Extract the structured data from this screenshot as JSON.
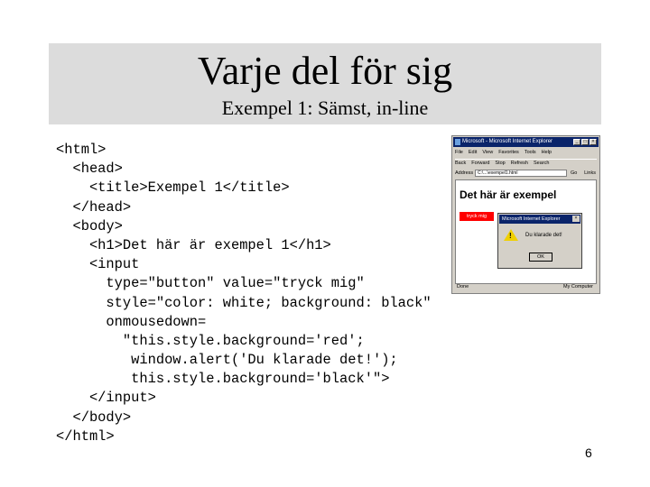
{
  "slide": {
    "title": "Varje del för sig",
    "subtitle": "Exempel 1: Sämst, in-line",
    "page_number": "6",
    "code_lines": [
      "<html>",
      "  <head>",
      "    <title>Exempel 1</title>",
      "  </head>",
      "  <body>",
      "    <h1>Det här är exempel 1</h1>",
      "    <input",
      "      type=\"button\" value=\"tryck mig\"",
      "      style=\"color: white; background: black\"",
      "      onmousedown=",
      "        \"this.style.background='red';",
      "         window.alert('Du klarade det!');",
      "         this.style.background='black'\">",
      "    </input>",
      "  </body>",
      "</html>"
    ]
  },
  "browser": {
    "title": "Microsoft - Microsoft Internet Explorer",
    "menu": [
      "File",
      "Edit",
      "View",
      "Favorites",
      "Tools",
      "Help"
    ],
    "toolbar": [
      "Back",
      "Forward",
      "Stop",
      "Refresh",
      "Search"
    ],
    "address_label": "Address",
    "address_value": "C:\\...\\exempel1.html",
    "go_label": "Go",
    "links_label": "Links",
    "heading": "Det här är exempel",
    "button_label": "tryck mig",
    "status_left": "Done",
    "status_right": "My Computer",
    "window_buttons": [
      "_",
      "□",
      "×"
    ]
  },
  "alert": {
    "title": "Microsoft Internet Explorer",
    "close": "×",
    "icon": "warning-icon",
    "icon_mark": "!",
    "message": "Du klarade det!",
    "ok_label": "OK"
  }
}
